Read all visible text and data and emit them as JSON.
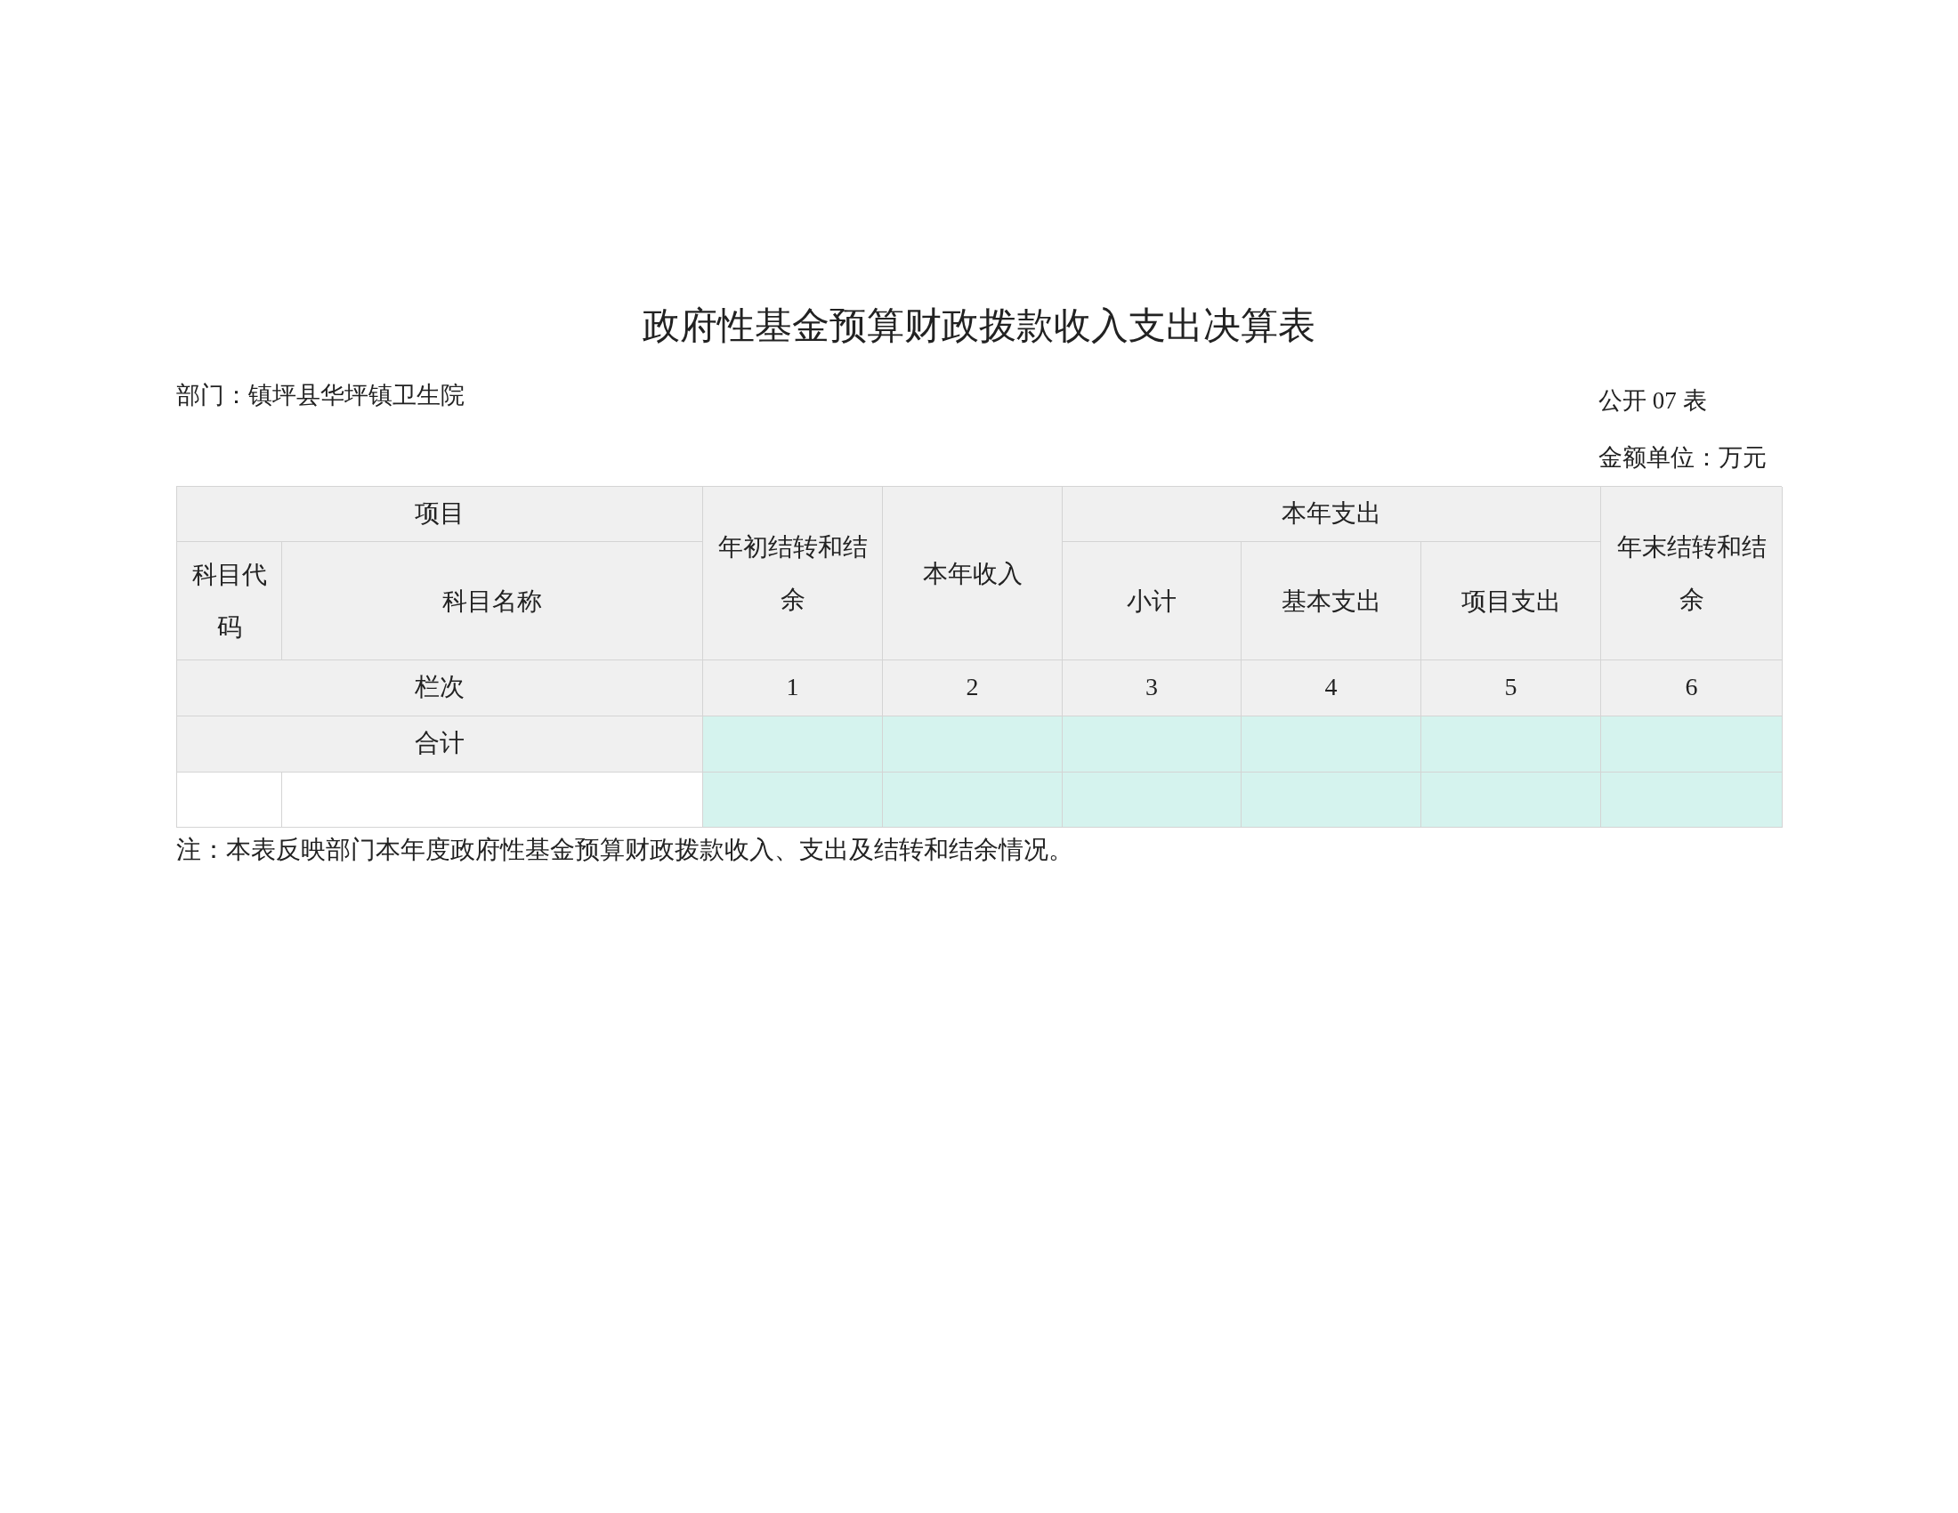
{
  "title": "政府性基金预算财政拨款收入支出决算表",
  "department": "部门：镇坪县华坪镇卫生院",
  "table_number": "公开 07 表",
  "unit": "金额单位：万元",
  "table": {
    "header": {
      "item": "项目",
      "opening_balance": "年初结转和结余",
      "income": "本年收入",
      "expenditure": "本年支出",
      "closing_balance": "年末结转和结余",
      "code": "科目代码",
      "name": "科目名称",
      "subtotal": "小计",
      "basic": "基本支出",
      "project": "项目支出"
    },
    "index_row": {
      "label": "栏次",
      "numbers": [
        "1",
        "2",
        "3",
        "4",
        "5",
        "6"
      ]
    },
    "rows": [
      {
        "kind": "total",
        "label": "合计"
      },
      {
        "kind": "blank"
      }
    ]
  },
  "note": "注：本表反映部门本年度政府性基金预算财政拨款收入、支出及结转和结余情况。"
}
